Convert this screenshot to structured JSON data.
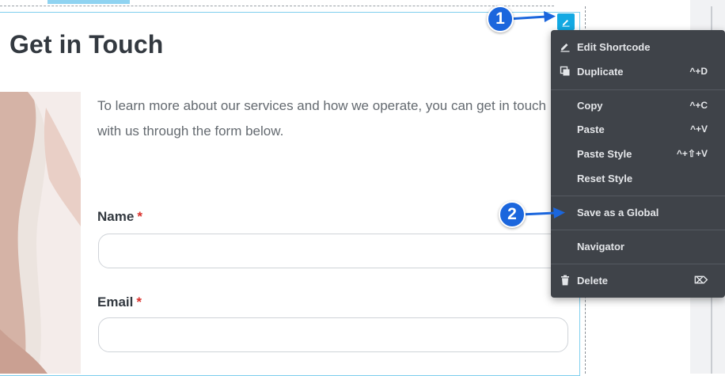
{
  "page": {
    "title": "Get in Touch",
    "intro": "To learn more about our services and how we operate, you can get in touch with us through the form below."
  },
  "form": {
    "fields": [
      {
        "label": "Name",
        "required_mark": "*",
        "value": ""
      },
      {
        "label": "Email",
        "required_mark": "*",
        "value": ""
      }
    ]
  },
  "edit_button": {
    "icon": "pencil-icon"
  },
  "context_menu": {
    "items": [
      {
        "id": "edit-shortcode",
        "label": "Edit Shortcode",
        "shortcut": "",
        "icon": "pencil-icon"
      },
      {
        "id": "duplicate",
        "label": "Duplicate",
        "shortcut": "^+D",
        "icon": "duplicate-icon"
      },
      {
        "id": "copy",
        "label": "Copy",
        "shortcut": "^+C",
        "icon": ""
      },
      {
        "id": "paste",
        "label": "Paste",
        "shortcut": "^+V",
        "icon": ""
      },
      {
        "id": "paste-style",
        "label": "Paste Style",
        "shortcut": "^+⇧+V",
        "icon": ""
      },
      {
        "id": "reset-style",
        "label": "Reset Style",
        "shortcut": "",
        "icon": ""
      },
      {
        "id": "save-as-global",
        "label": "Save as a Global",
        "shortcut": "",
        "icon": ""
      },
      {
        "id": "navigator",
        "label": "Navigator",
        "shortcut": "",
        "icon": ""
      },
      {
        "id": "delete",
        "label": "Delete",
        "shortcut": "⌦",
        "icon": "trash-icon"
      }
    ]
  },
  "annotations": [
    {
      "number": "1"
    },
    {
      "number": "2"
    }
  ],
  "colors": {
    "accent": "#12a9e3",
    "menu_bg": "#3f4349",
    "badge": "#1b66dd",
    "required": "#d9302b",
    "heading": "#333940"
  }
}
